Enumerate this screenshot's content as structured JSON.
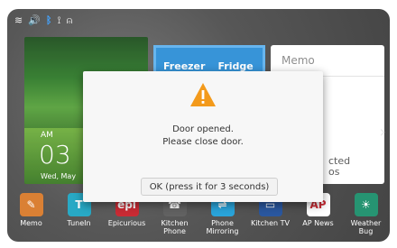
{
  "status_bar": {
    "icons": [
      "wifi-icon",
      "volume-icon",
      "bluetooth-icon",
      "link-icon",
      "alarm-icon"
    ],
    "glyphs": {
      "wifi": "≋",
      "volume": "🔊",
      "bluetooth": "ᛒ",
      "link": "⟟",
      "alarm": "⍝"
    }
  },
  "widgets": {
    "clock": {
      "ampm": "AM",
      "time": "03",
      "date": "Wed, May"
    },
    "fridge": {
      "label_left": "Freezer",
      "label_right": "Fridge"
    },
    "memo": {
      "title": "Memo",
      "line1": "cted",
      "line2": "os"
    }
  },
  "apps": [
    {
      "label": "Memo",
      "icon": "memo-icon",
      "color": "#d97a2a",
      "glyph": "✎"
    },
    {
      "label": "TuneIn",
      "icon": "tunein-icon",
      "color": "#1da5c2",
      "glyph": "T"
    },
    {
      "label": "Epicurious",
      "icon": "epicurious-icon",
      "color": "#c8202a",
      "glyph": "epi"
    },
    {
      "label": "Kitchen Phone",
      "icon": "kitchen-phone-icon",
      "color": "#5a5a5a",
      "glyph": "☎"
    },
    {
      "label": "Phone Mirroring",
      "icon": "phone-mirroring-icon",
      "color": "#1ea0d8",
      "glyph": "⇌"
    },
    {
      "label": "Kitchen TV",
      "icon": "kitchen-tv-icon",
      "color": "#1f4f9a",
      "glyph": "▭"
    },
    {
      "label": "AP News",
      "icon": "ap-news-icon",
      "color": "#ffffff",
      "glyph": "AP"
    },
    {
      "label": "Weather Bug",
      "icon": "weather-bug-icon",
      "color": "#1b8f6b",
      "glyph": "☀"
    }
  ],
  "dialog": {
    "line1": "Door opened.",
    "line2": "Please close door.",
    "ok_label": "OK (press it for 3 seconds)"
  },
  "pager": {
    "count": 2,
    "active": 0
  }
}
